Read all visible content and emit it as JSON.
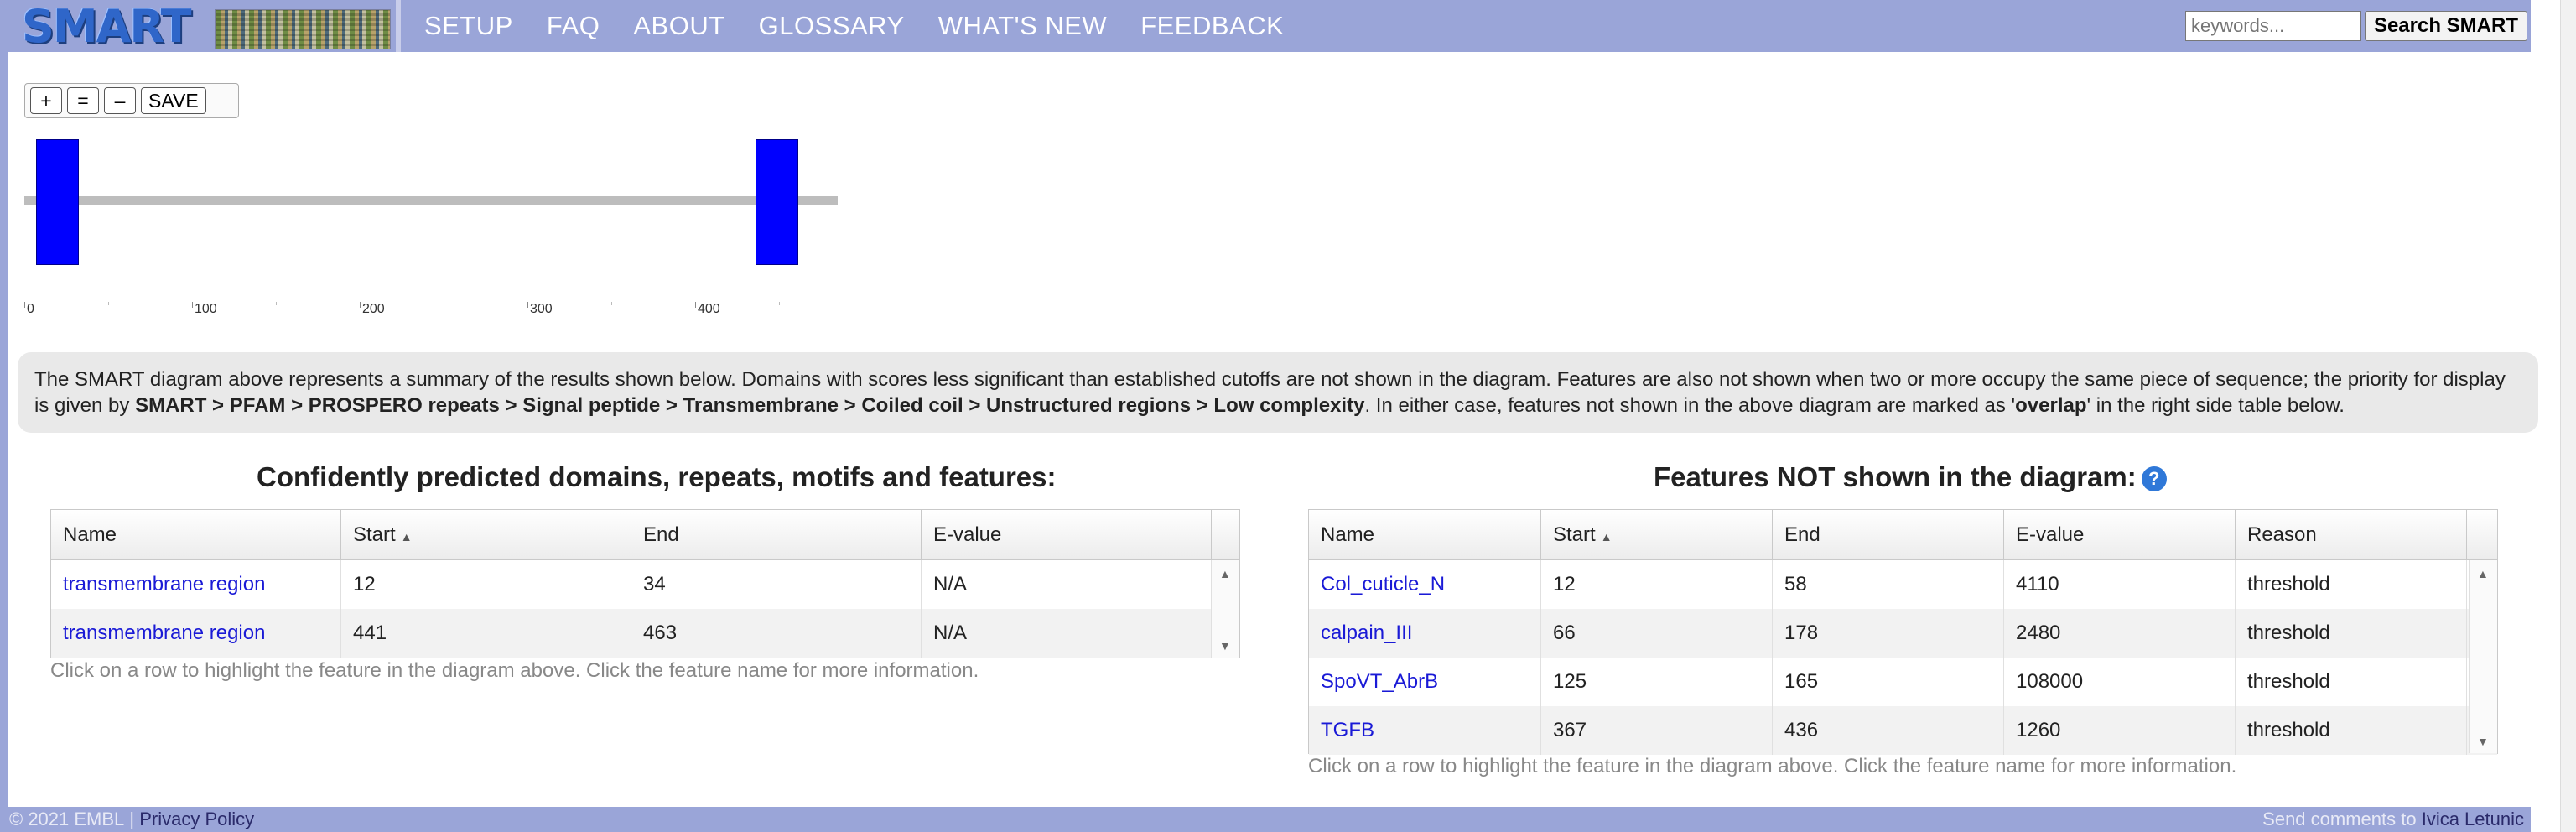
{
  "header": {
    "logo_text": "SMART",
    "nav": [
      "SETUP",
      "FAQ",
      "ABOUT",
      "GLOSSARY",
      "WHAT'S NEW",
      "FEEDBACK"
    ],
    "search_placeholder": "keywords...",
    "search_button": "Search SMART"
  },
  "zoom": {
    "plus": "+",
    "equal": "=",
    "minus": "–",
    "save": "SAVE"
  },
  "diagram": {
    "sequence_length": 480,
    "domains": [
      {
        "start": 12,
        "end": 34,
        "color": "#0000ff"
      },
      {
        "start": 441,
        "end": 463,
        "color": "#0000ff"
      }
    ],
    "ticks": [
      "0",
      "100",
      "200",
      "300",
      "400"
    ]
  },
  "info": {
    "part1": "The SMART diagram above represents a summary of the results shown below. Domains with scores less significant than established cutoffs are not shown in the diagram. Features are also not shown when two or more occupy the same piece of sequence; the priority for display is given by ",
    "priority": "SMART > PFAM > PROSPERO repeats > Signal peptide > Transmembrane > Coiled coil > Unstructured regions > Low complexity",
    "part2": ". In either case, features not shown in the above diagram are marked as '",
    "overlap": "overlap",
    "part3": "' in the right side table below."
  },
  "left_table": {
    "title": "Confidently predicted domains, repeats, motifs and features:",
    "columns": [
      "Name",
      "Start",
      "End",
      "E-value"
    ],
    "rows": [
      {
        "name": "transmembrane region",
        "start": "12",
        "end": "34",
        "evalue": "N/A"
      },
      {
        "name": "transmembrane region",
        "start": "441",
        "end": "463",
        "evalue": "N/A"
      }
    ],
    "hint": "Click on a row to highlight the feature in the diagram above. Click the feature name for more information."
  },
  "right_table": {
    "title": "Features NOT shown in the diagram:",
    "help_icon": "?",
    "columns": [
      "Name",
      "Start",
      "End",
      "E-value",
      "Reason"
    ],
    "rows": [
      {
        "name": "Col_cuticle_N",
        "start": "12",
        "end": "58",
        "evalue": "4110",
        "reason": "threshold"
      },
      {
        "name": "calpain_III",
        "start": "66",
        "end": "178",
        "evalue": "2480",
        "reason": "threshold"
      },
      {
        "name": "SpoVT_AbrB",
        "start": "125",
        "end": "165",
        "evalue": "108000",
        "reason": "threshold"
      },
      {
        "name": "TGFB",
        "start": "367",
        "end": "436",
        "evalue": "1260",
        "reason": "threshold"
      }
    ],
    "hint": "Click on a row to highlight the feature in the diagram above. Click the feature name for more information."
  },
  "footer": {
    "copyright": "© 2021 EMBL",
    "separator": " | ",
    "privacy": "Privacy Policy",
    "send_comments": "Send comments to ",
    "author": "Ivica Letunic"
  }
}
